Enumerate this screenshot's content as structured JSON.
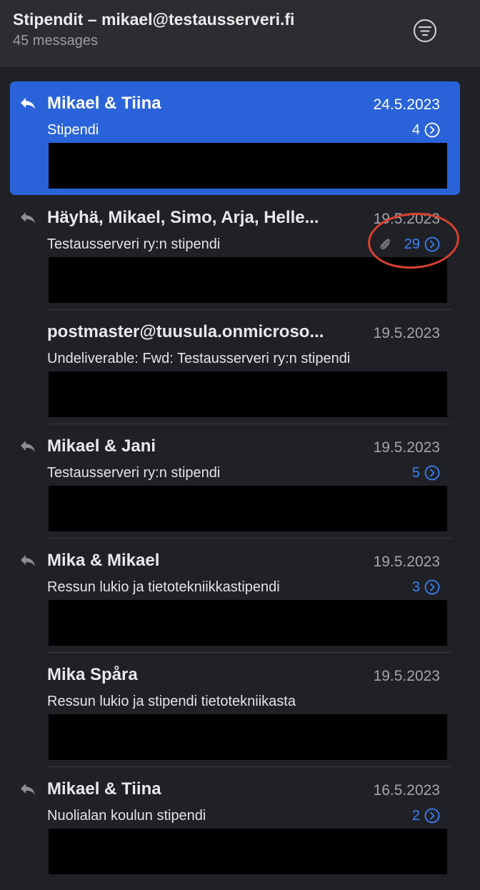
{
  "header": {
    "title": "Stipendit – mikael@testausserveri.fi",
    "count": "45 messages",
    "filter_icon": "filter-icon"
  },
  "colors": {
    "selected_bg": "#2a63d9",
    "thread_count": "#3b82f6",
    "annotation": "#d8412f",
    "background": "#1f2126"
  },
  "messages": [
    {
      "sender": "Mikael & Tiina",
      "date": "24.5.2023",
      "subject": "Stipendi",
      "thread_count": "4",
      "replied": true,
      "attachment": false,
      "selected": true
    },
    {
      "sender": "Häyhä, Mikael, Simo, Arja, Helle...",
      "date": "19.5.2023",
      "subject": "Testausserveri ry:n stipendi",
      "thread_count": "29",
      "replied": true,
      "attachment": true,
      "selected": false
    },
    {
      "sender": "postmaster@tuusula.onmicroso...",
      "date": "19.5.2023",
      "subject": "Undeliverable: Fwd: Testausserveri ry:n stipendi",
      "thread_count": "",
      "replied": false,
      "attachment": false,
      "selected": false
    },
    {
      "sender": "Mikael & Jani",
      "date": "19.5.2023",
      "subject": "Testausserveri ry:n stipendi",
      "thread_count": "5",
      "replied": true,
      "attachment": false,
      "selected": false
    },
    {
      "sender": "Mika & Mikael",
      "date": "19.5.2023",
      "subject": "Ressun lukio ja tietotekniikkastipendi",
      "thread_count": "3",
      "replied": true,
      "attachment": false,
      "selected": false
    },
    {
      "sender": "Mika Spåra",
      "date": "19.5.2023",
      "subject": "Ressun lukio ja stipendi tietotekniikasta",
      "thread_count": "",
      "replied": false,
      "attachment": false,
      "selected": false
    },
    {
      "sender": "Mikael & Tiina",
      "date": "16.5.2023",
      "subject": "Nuolialan koulun stipendi",
      "thread_count": "2",
      "replied": true,
      "attachment": false,
      "selected": false
    }
  ]
}
